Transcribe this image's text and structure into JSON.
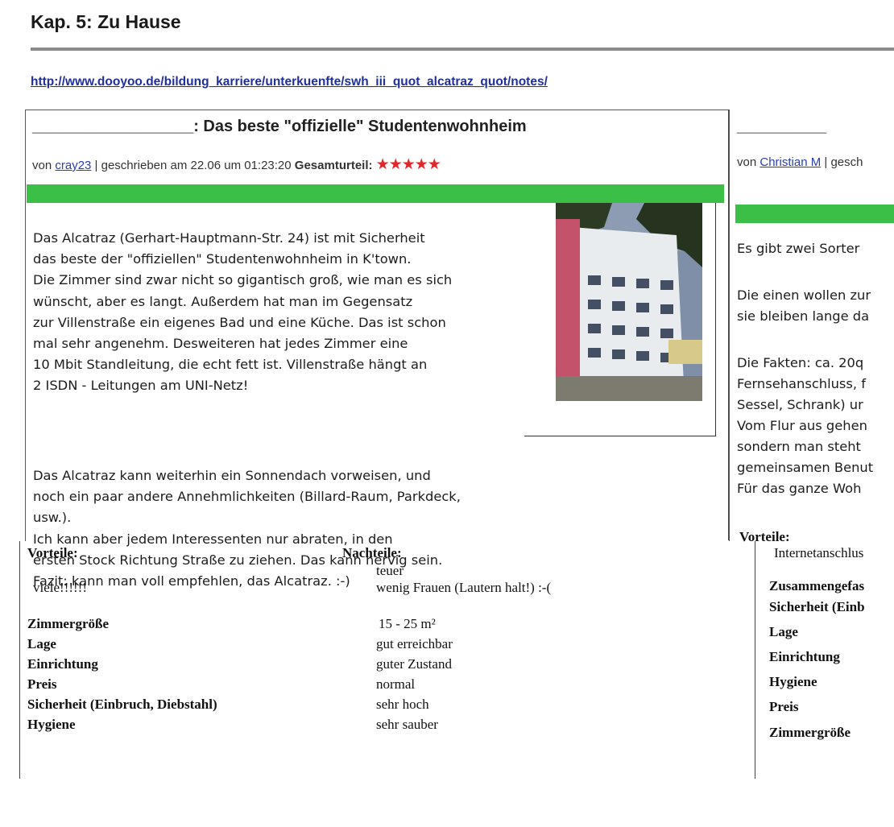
{
  "header": {
    "title": "Kap. 5: Zu Hause",
    "url": "http://www.dooyoo.de/bildung_karriere/unterkuenfte/swh_iii_quot_alcatraz_quot/notes/"
  },
  "review1": {
    "title": "__________________: Das beste \"offizielle\" Studentenwohnheim",
    "meta_prefix": "von ",
    "author": "cray23",
    "meta_date": " | geschrieben am 22.06 um 01:23:20 ",
    "rating_label": "Gesamturteil:",
    "stars": "★★★★★",
    "text_block1": "Das Alcatraz (Gerhart-Hauptmann-Str. 24) ist mit Sicherheit\ndas beste der \"offiziellen\" Studentenwohnheim in K'town.\nDie Zimmer sind zwar nicht so gigantisch groß, wie man es sich\nwünscht, aber es langt. Außerdem hat man im Gegensatz\nzur Villenstraße ein eigenes Bad und eine Küche. Das ist schon\nmal sehr angenehm. Desweiteren hat jedes Zimmer eine\n10 Mbit Standleitung, die echt fett ist. Villenstraße hängt an\n2 ISDN - Leitungen am UNI-Netz!",
    "text_block2": "Das Alcatraz kann weiterhin ein Sonnendach vorweisen, und\nnoch ein paar andere Annehmlichkeiten (Billard-Raum, Parkdeck,\nusw.).\nIch kann aber jedem Interessenten nur abraten, in den\nersten Stock Richtung Straße zu ziehen. Das kann nervig sein.\nFazit: kann man voll empfehlen, das Alcatraz. :-)",
    "pros_label": "Vorteile:",
    "cons_label": "Nachteile:",
    "pros": [
      "viele!!!!!!"
    ],
    "cons": [
      "teuer",
      "wenig Frauen (Lautern halt!) :-("
    ],
    "ratings": [
      {
        "label": "Zimmergröße",
        "value": "15 - 25 m²"
      },
      {
        "label": "Lage",
        "value": "gut erreichbar"
      },
      {
        "label": "Einrichtung",
        "value": "guter Zustand"
      },
      {
        "label": "Preis",
        "value": "normal"
      },
      {
        "label": "Sicherheit (Einbruch, Diebstahl)",
        "value": "sehr hoch"
      },
      {
        "label": "Hygiene",
        "value": "sehr sauber"
      }
    ]
  },
  "review2": {
    "title": "__________",
    "meta_prefix": "von ",
    "author": "Christian M",
    "meta_rest": " | gesch",
    "text_lines": [
      "Es gibt zwei Sorter",
      "Die einen wollen zur",
      "sie bleiben lange da",
      "Die Fakten: ca. 20q",
      "Fernsehanschluss, f",
      "Sessel, Schrank) ur",
      "Vom Flur aus gehen",
      "sondern man steht",
      "gemeinsamen Benut",
      "Für das ganze Woh"
    ],
    "pros_label": "Vorteile:",
    "pros_value": "Internetanschlus",
    "summary_label": "Zusammengefas",
    "rating_labels": [
      "Sicherheit (Einb",
      "Lage",
      "Einrichtung",
      "Hygiene",
      "Preis",
      "Zimmergröße"
    ]
  },
  "colors": {
    "link": "#1f2f9c",
    "rating_green": "#3cbf46",
    "stars": "#e0282c"
  }
}
